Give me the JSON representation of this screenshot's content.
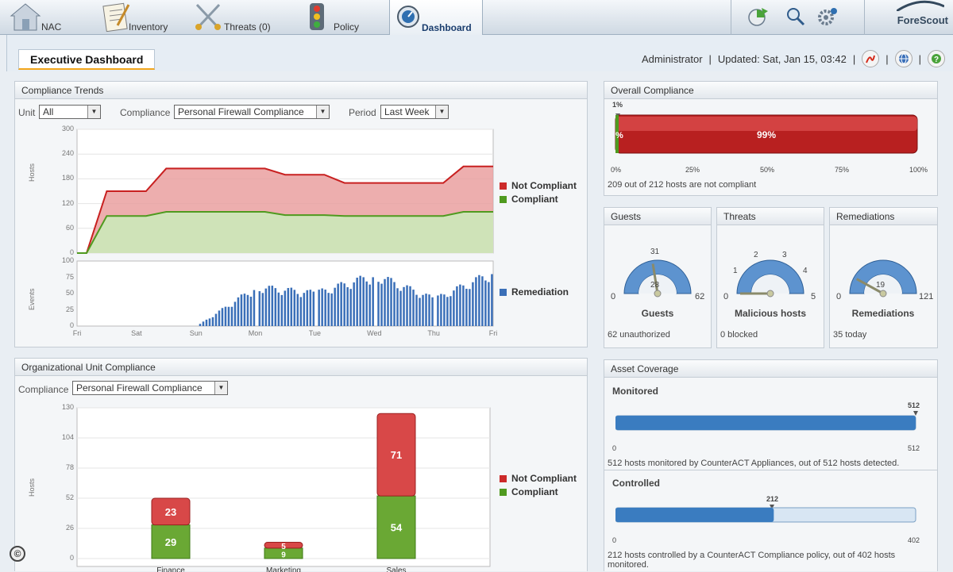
{
  "nav": {
    "tabs": [
      {
        "label": "NAC",
        "icon": "house-icon"
      },
      {
        "label": "Inventory",
        "icon": "checklist-icon"
      },
      {
        "label": "Threats (0)",
        "icon": "swords-icon"
      },
      {
        "label": "Policy",
        "icon": "traffic-light-icon"
      },
      {
        "label": "Dashboard",
        "icon": "speedometer-icon",
        "active": true
      }
    ],
    "brand": "ForeScout"
  },
  "header": {
    "tab": "Executive Dashboard",
    "user": "Administrator",
    "updated": "Updated:  Sat, Jan 15, 03:42",
    "sep": "|"
  },
  "compliance_trends": {
    "title": "Compliance Trends",
    "unit_label": "Unit",
    "unit_value": "All",
    "compliance_label": "Compliance",
    "compliance_value": "Personal Firewall Compliance",
    "period_label": "Period",
    "period_value": "Last Week",
    "hosts_axis": "Hosts",
    "events_axis": "Events",
    "hosts_ticks": [
      "300",
      "240",
      "180",
      "120",
      "60",
      "0"
    ],
    "events_ticks": [
      "100",
      "75",
      "50",
      "25",
      "0"
    ],
    "days": [
      "Fri",
      "Sat",
      "Sun",
      "Mon",
      "Tue",
      "Wed",
      "Thu",
      "Fri"
    ],
    "legend": [
      "Not Compliant",
      "Compliant",
      "Remediation"
    ]
  },
  "org_unit": {
    "title": "Organizational Unit Compliance",
    "compliance_label": "Compliance",
    "compliance_value": "Personal Firewall Compliance",
    "y_axis": "Hosts",
    "ticks": [
      "130",
      "104",
      "78",
      "52",
      "26",
      "0"
    ],
    "legend": [
      "Not Compliant",
      "Compliant"
    ]
  },
  "overall": {
    "title": "Overall Compliance",
    "left_pct": "1%",
    "left_in_bar": "%",
    "bar_pct": "99%",
    "ticks": [
      "0%",
      "25%",
      "50%",
      "75%",
      "100%"
    ],
    "note": "209 out of 212 hosts are not compliant"
  },
  "gauges": [
    {
      "title": "Guests",
      "label": "Guests",
      "min": "0",
      "max": "62",
      "marker": "31",
      "value": "28",
      "note": "62  unauthorized"
    },
    {
      "title": "Threats",
      "label": "Malicious hosts",
      "min": "0",
      "max": "5",
      "ticks": [
        "1",
        "2",
        "3",
        "4"
      ],
      "value": "0",
      "note": "0  blocked"
    },
    {
      "title": "Remediations",
      "label": "Remediations",
      "min": "0",
      "max": "121",
      "value": "19",
      "note": "35  today"
    }
  ],
  "asset": {
    "title": "Asset Coverage",
    "monitored_title": "Monitored",
    "monitored_marker": "512",
    "monitored_min": "0",
    "monitored_max": "512",
    "monitored_note": "512 hosts monitored by CounterACT Appliances, out of 512 hosts detected.",
    "controlled_title": "Controlled",
    "controlled_marker": "212",
    "controlled_min": "0",
    "controlled_max": "402",
    "controlled_note": "212 hosts controlled by a CounterACT Compliance policy, out of 402 hosts monitored."
  },
  "chart_data": [
    {
      "type": "area",
      "x": [
        "Fri",
        "Sat",
        "Sun",
        "Mon",
        "Tue",
        "Wed",
        "Thu",
        "Fri"
      ],
      "ylabel": "Hosts",
      "ylim": [
        0,
        300
      ],
      "series": [
        {
          "name": "Not Compliant",
          "values": [
            0,
            150,
            205,
            205,
            190,
            170,
            170,
            210
          ],
          "color": "#cc2a2a"
        },
        {
          "name": "Compliant",
          "values": [
            0,
            90,
            100,
            100,
            92,
            90,
            90,
            100
          ],
          "color": "#5a9a2a"
        }
      ]
    },
    {
      "type": "bar",
      "x": [
        "Fri",
        "Sat",
        "Sun",
        "Mon",
        "Tue",
        "Wed",
        "Thu",
        "Fri"
      ],
      "ylabel": "Events",
      "ylim": [
        0,
        100
      ],
      "series": [
        {
          "name": "Remediation",
          "values": [
            0,
            0,
            0,
            65,
            55,
            85,
            45,
            90
          ],
          "color": "#3a6fb8"
        }
      ]
    },
    {
      "type": "bar",
      "categories": [
        "Finance",
        "Marketing",
        "Sales"
      ],
      "ylabel": "Hosts",
      "ylim": [
        0,
        130
      ],
      "series": [
        {
          "name": "Compliant",
          "values": [
            29,
            9,
            54
          ],
          "color": "#5a9a2a"
        },
        {
          "name": "Not Compliant",
          "values": [
            23,
            5,
            71
          ],
          "color": "#cc2a2a"
        }
      ]
    }
  ]
}
